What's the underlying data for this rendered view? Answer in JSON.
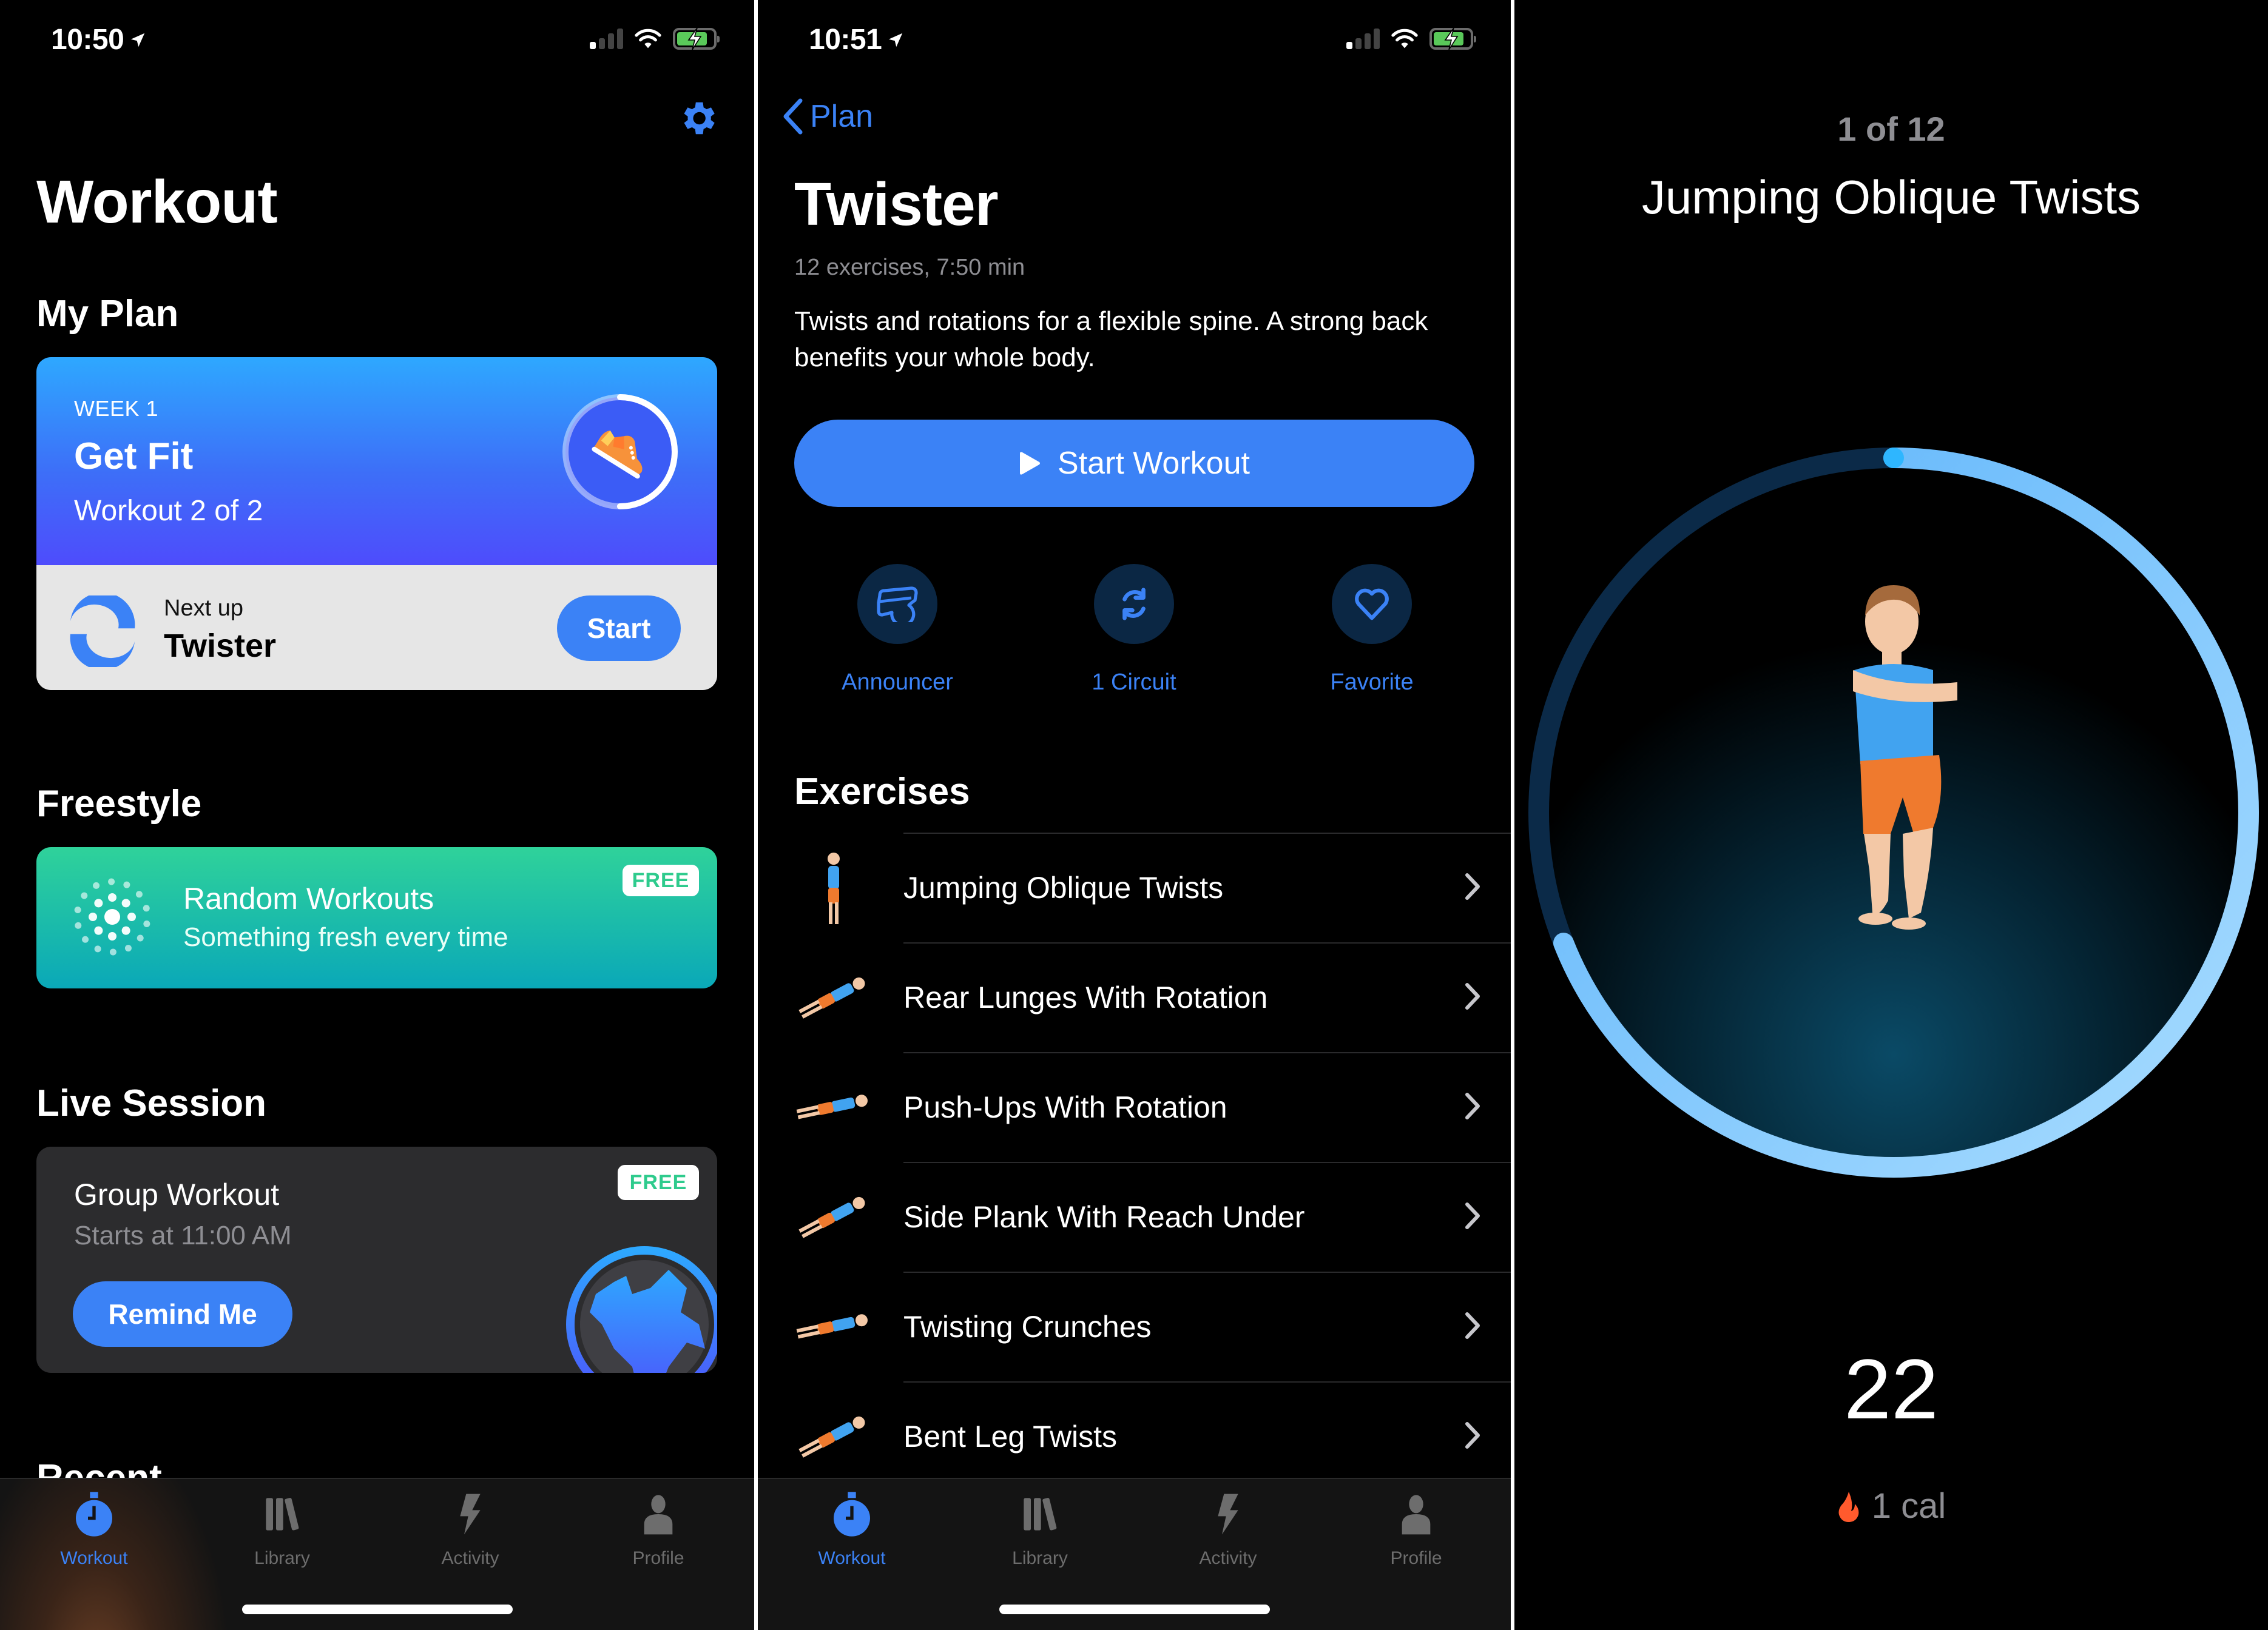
{
  "colors": {
    "accent": "#3b82f6",
    "free_green": "#2ecb8d",
    "tab_inactive": "#6d6d6d",
    "ring_progress": "#6cc0ff",
    "ring_track": "#0b2a48",
    "flame": "#ff5a2d"
  },
  "screen1": {
    "status": {
      "time": "10:50",
      "location_icon": "location-arrow-icon",
      "signal_bars": 1,
      "wifi": "wifi-icon",
      "battery_level": 0.85,
      "charging": true
    },
    "settings_icon": "gear-icon",
    "title": "Workout",
    "my_plan": {
      "heading": "My Plan",
      "week": "WEEK 1",
      "name": "Get Fit",
      "progress_text": "Workout 2 of 2",
      "ring_progress": 0.5,
      "icon": "sneaker-icon",
      "next_up_label": "Next up",
      "next_up_name": "Twister",
      "next_up_icon": "twister-icon",
      "start_label": "Start"
    },
    "freestyle": {
      "heading": "Freestyle",
      "title": "Random Workouts",
      "subtitle": "Something fresh every time",
      "badge": "FREE",
      "icon": "random-dots-icon"
    },
    "live_session": {
      "heading": "Live Session",
      "title": "Group Workout",
      "subtitle": "Starts at 11:00 AM",
      "badge": "FREE",
      "button": "Remind Me",
      "icon": "globe-icon"
    },
    "clipped_heading": "Recent"
  },
  "tabbar": {
    "items": [
      {
        "label": "Workout",
        "icon": "stopwatch-icon",
        "active": true
      },
      {
        "label": "Library",
        "icon": "books-icon",
        "active": false
      },
      {
        "label": "Activity",
        "icon": "bolt-icon",
        "active": false
      },
      {
        "label": "Profile",
        "icon": "person-icon",
        "active": false
      }
    ]
  },
  "screen2": {
    "status": {
      "time": "10:51",
      "signal_bars": 1,
      "battery_level": 0.85,
      "charging": true
    },
    "back_label": "Plan",
    "title": "Twister",
    "meta": "12 exercises, 7:50 min",
    "description": "Twists and rotations for a flexible spine. A strong back benefits your whole body.",
    "start_button": "Start Workout",
    "actions": [
      {
        "label": "Announcer",
        "icon": "whistle-icon"
      },
      {
        "label": "1 Circuit",
        "icon": "repeat-icon"
      },
      {
        "label": "Favorite",
        "icon": "heart-icon"
      }
    ],
    "exercises_heading": "Exercises",
    "exercises": [
      {
        "name": "Jumping Oblique Twists"
      },
      {
        "name": "Rear Lunges With Rotation"
      },
      {
        "name": "Push-Ups With Rotation"
      },
      {
        "name": "Side Plank With Reach Under"
      },
      {
        "name": "Twisting Crunches"
      },
      {
        "name": "Bent Leg Twists"
      }
    ]
  },
  "screen3": {
    "counter": "1 of 12",
    "exercise_title": "Jumping Oblique Twists",
    "ring_progress": 0.69,
    "countdown": "22",
    "calories": "1 cal",
    "calorie_icon": "flame-icon"
  }
}
